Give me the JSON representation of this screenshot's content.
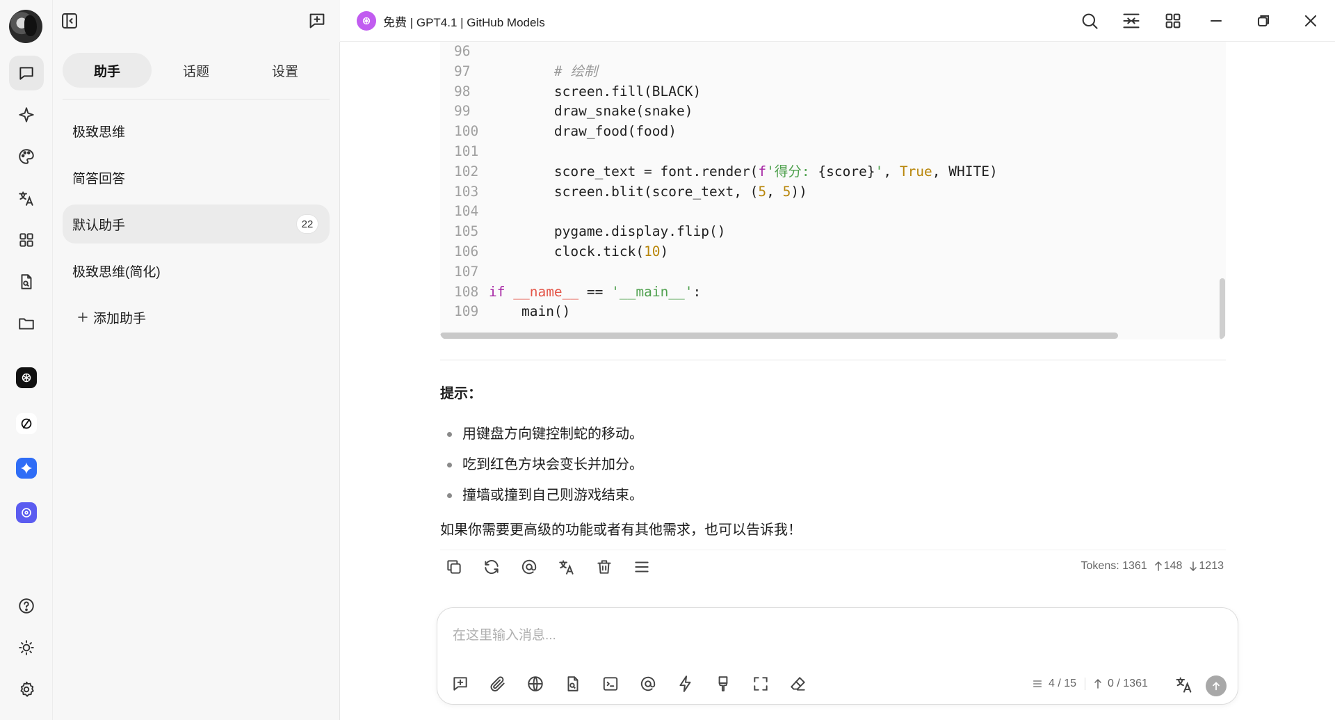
{
  "window": {
    "model_title": "免费 | GPT4.1 | GitHub Models"
  },
  "sidebar": {
    "tabs": [
      {
        "label": "助手",
        "active": true
      },
      {
        "label": "话题",
        "active": false
      },
      {
        "label": "设置",
        "active": false
      }
    ],
    "assistants": [
      {
        "label": "极致思维",
        "active": false
      },
      {
        "label": "简答回答",
        "active": false
      },
      {
        "label": "默认助手",
        "active": true,
        "badge": "22"
      },
      {
        "label": "极致思维(简化)",
        "active": false
      }
    ],
    "add_label": "添加助手"
  },
  "code": {
    "lines": [
      {
        "n": "96"
      },
      {
        "n": "97"
      },
      {
        "n": "98"
      },
      {
        "n": "99"
      },
      {
        "n": "100"
      },
      {
        "n": "101"
      },
      {
        "n": "102"
      },
      {
        "n": "103"
      },
      {
        "n": "104"
      },
      {
        "n": "105"
      },
      {
        "n": "106"
      },
      {
        "n": "107"
      },
      {
        "n": "108"
      },
      {
        "n": "109"
      }
    ],
    "t": {
      "c97": "# 绘制",
      "c98": "screen.fill(BLACK)",
      "c99": "draw_snake(snake)",
      "c100": "draw_food(food)",
      "c102a": "score_text = font.render(",
      "c102b": "f",
      "c102c": "'得分: ",
      "c102d": "{score}",
      "c102e": "'",
      "c102f": ", ",
      "c102g": "True",
      "c102h": ", WHITE)",
      "c103a": "screen.blit(score_text, (",
      "c103b": "5",
      "c103c": ", ",
      "c103d": "5",
      "c103e": "))",
      "c105": "pygame.display.flip()",
      "c106a": "clock.tick(",
      "c106b": "10",
      "c106c": ")",
      "c108a": "if",
      "c108b": "__name__",
      "c108c": "==",
      "c108d": "'__main__'",
      "c108e": ":",
      "c109": "main()"
    }
  },
  "message": {
    "hint_title": "提示：",
    "bullets": [
      "用键盘方向键控制蛇的移动。",
      "吃到红色方块会变长并加分。",
      "撞墙或撞到自己则游戏结束。"
    ],
    "closing": "如果你需要更高级的功能或者有其他需求，也可以告诉我！",
    "tokens_label": "Tokens: 1361",
    "tokens_up": "148",
    "tokens_down": "1213"
  },
  "input": {
    "placeholder": "在这里输入消息...",
    "context_count": "4 / 15",
    "token_count": "0 / 1361"
  }
}
